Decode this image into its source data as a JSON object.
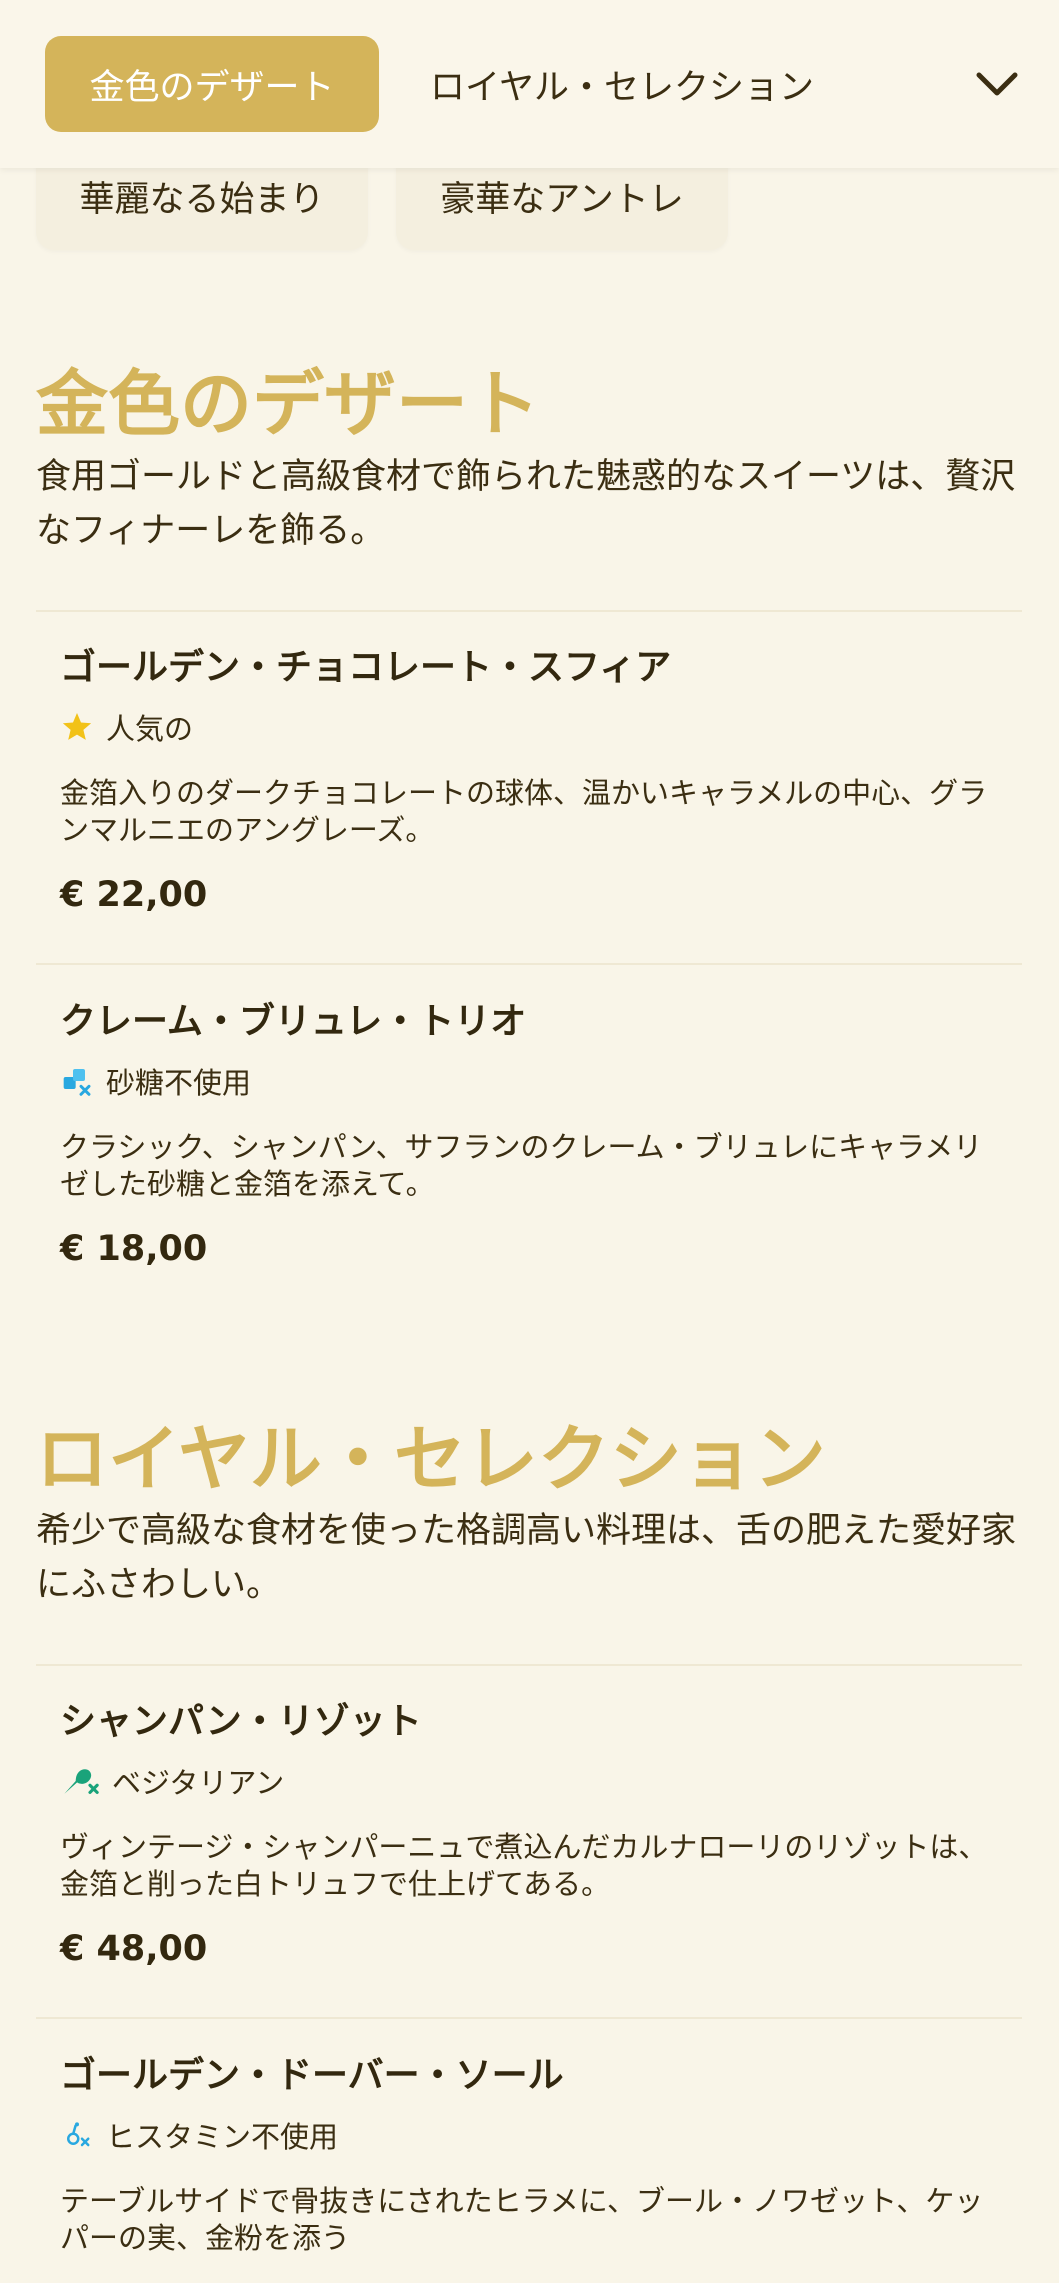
{
  "nav": {
    "active_tab": "金色のデザート",
    "tab2": "ロイヤル・セレクション",
    "dropdown_icon": "chevron-down-icon",
    "chips": [
      "華麗なる始まり",
      "豪華なアントレ"
    ]
  },
  "sections": [
    {
      "title": "金色のデザート",
      "description": "食用ゴールドと高級食材で飾られた魅惑的なスイーツは、贅沢なフィナーレを飾る。",
      "items": [
        {
          "name": "ゴールデン・チョコレート・スフィア",
          "tag_icon": "star-icon",
          "tag": "人気の",
          "description": "金箔入りのダークチョコレートの球体、温かいキャラメルの中心、グランマルニエのアングレーズ。",
          "price": "€ 22,00"
        },
        {
          "name": "クレーム・ブリュレ・トリオ",
          "tag_icon": "sugar-free-icon",
          "tag": "砂糖不使用",
          "description": "クラシック、シャンパン、サフランのクレーム・ブリュレにキャラメリゼした砂糖と金箔を添えて。",
          "price": "€ 18,00"
        }
      ]
    },
    {
      "title": "ロイヤル・セレクション",
      "description": "希少で高級な食材を使った格調高い料理は、舌の肥えた愛好家にふさわしい。",
      "items": [
        {
          "name": "シャンパン・リゾット",
          "tag_icon": "vegetarian-icon",
          "tag": "ベジタリアン",
          "description": "ヴィンテージ・シャンパーニュで煮込んだカルナローリのリゾットは、金箔と削った白トリュフで仕上げてある。",
          "price": "€ 48,00"
        },
        {
          "name": "ゴールデン・ドーバー・ソール",
          "tag_icon": "histamine-free-icon",
          "tag": "ヒスタミン不使用",
          "description": "テーブルサイドで骨抜きにされたヒラメに、ブール・ノワゼット、ケッパーの実、金粉を添う",
          "price": ""
        }
      ]
    }
  ],
  "colors": {
    "accent": "#d4b45a",
    "background": "#f9f5e8",
    "text": "#3b2e12",
    "star": "#f2c218",
    "sugar_icon": "#29a8e0",
    "veg_icon": "#1aa37a"
  }
}
